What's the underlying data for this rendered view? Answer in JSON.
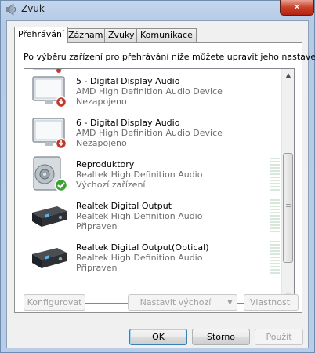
{
  "window": {
    "title": "Zvuk",
    "close_label": "✕"
  },
  "tabs": [
    {
      "label": "Přehrávání",
      "active": true
    },
    {
      "label": "Záznam",
      "active": false
    },
    {
      "label": "Zvuky",
      "active": false
    },
    {
      "label": "Komunikace",
      "active": false
    }
  ],
  "instruction": "Po výběru zařízení pro přehrávání níže můžete upravit jeho nastavení:",
  "devices": [
    {
      "name": "5 - Digital Display Audio",
      "driver": "AMD High Definition Audio Device",
      "status": "Nezapojeno",
      "icon": "monitor-icon",
      "badge": "disconnected-icon"
    },
    {
      "name": "6 - Digital Display Audio",
      "driver": "AMD High Definition Audio Device",
      "status": "Nezapojeno",
      "icon": "monitor-icon",
      "badge": "disconnected-icon"
    },
    {
      "name": "Reproduktory",
      "driver": "Realtek High Definition Audio",
      "status": "Výchozí zařízení",
      "icon": "speaker-icon",
      "badge": "default-check-icon"
    },
    {
      "name": "Realtek Digital Output",
      "driver": "Realtek High Definition Audio",
      "status": "Připraven",
      "icon": "digital-output-icon",
      "badge": ""
    },
    {
      "name": "Realtek Digital Output(Optical)",
      "driver": "Realtek High Definition Audio",
      "status": "Připraven",
      "icon": "digital-output-icon",
      "badge": ""
    }
  ],
  "buttons": {
    "configure": "Konfigurovat",
    "set_default": "Nastavit výchozí",
    "properties": "Vlastnosti",
    "ok": "OK",
    "cancel": "Storno",
    "apply": "Použít"
  },
  "colors": {
    "accent": "#3c7fb1",
    "disconnected_badge": "#c0392b",
    "default_check": "#3ea135",
    "meter_idle": "#d7e8da"
  }
}
